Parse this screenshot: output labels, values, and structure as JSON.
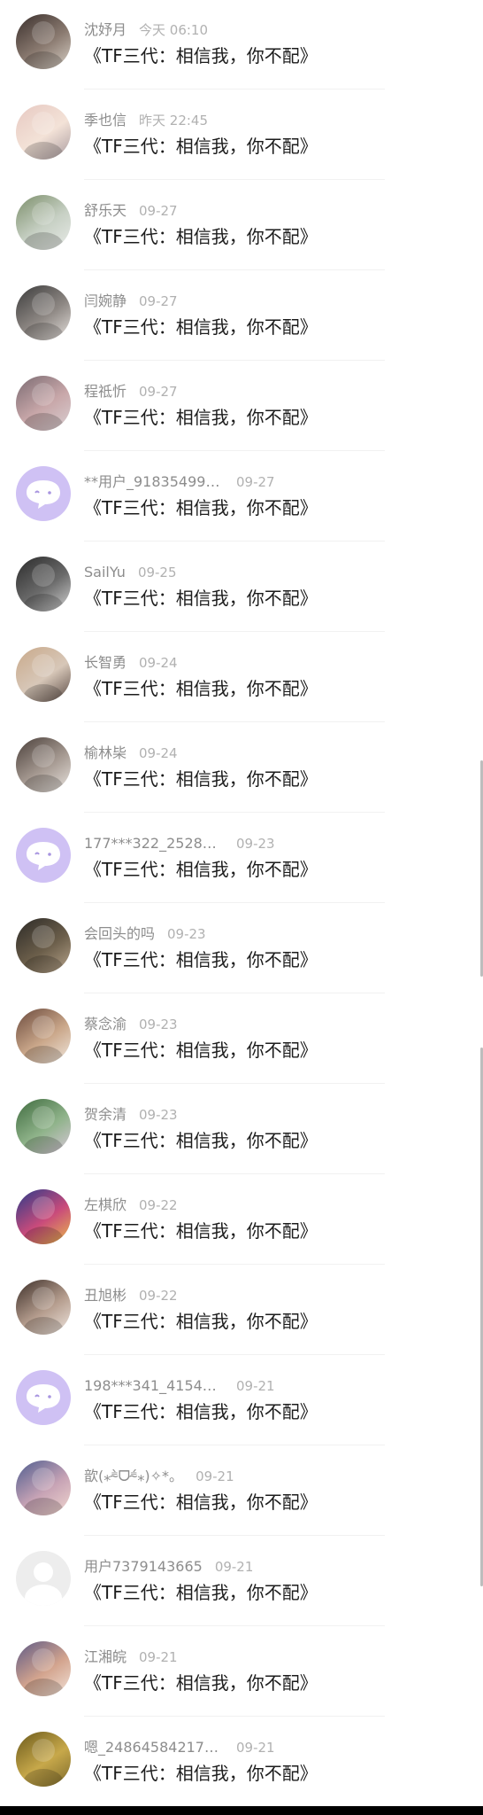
{
  "comments": [
    {
      "name": "沈妤月",
      "time": "今天 06:10",
      "content": "《TF三代：相信我，你不配》",
      "avatar": "photo",
      "colors": [
        "#3a2f2c",
        "#8a7a70",
        "#d8d0c6"
      ]
    },
    {
      "name": "季也信",
      "time": "昨天 22:45",
      "content": "《TF三代：相信我，你不配》",
      "avatar": "photo",
      "colors": [
        "#e7c9c2",
        "#f3e2d7",
        "#a99b9f"
      ]
    },
    {
      "name": "舒乐天",
      "time": "09-27",
      "content": "《TF三代：相信我，你不配》",
      "avatar": "photo",
      "colors": [
        "#7c8f6b",
        "#c7d0c4",
        "#e8ebe8"
      ]
    },
    {
      "name": "闫婉静",
      "time": "09-27",
      "content": "《TF三代：相信我，你不配》",
      "avatar": "photo",
      "colors": [
        "#3b3b3b",
        "#8d8783",
        "#e6e1dd"
      ]
    },
    {
      "name": "程祗忻",
      "time": "09-27",
      "content": "《TF三代：相信我，你不配》",
      "avatar": "photo",
      "colors": [
        "#7b6b72",
        "#c8a7a9",
        "#d9cfd2"
      ]
    },
    {
      "name": "**用户_91835499…",
      "time": "09-27",
      "content": "《TF三代：相信我，你不配》",
      "avatar": "default",
      "colors": [
        "#cfc1f4"
      ]
    },
    {
      "name": "SailYu",
      "time": "09-25",
      "content": "《TF三代：相信我，你不配》",
      "avatar": "photo",
      "colors": [
        "#2a2a2a",
        "#6a6a6a",
        "#d2d2d2"
      ]
    },
    {
      "name": "长智勇",
      "time": "09-24",
      "content": "《TF三代：相信我，你不配》",
      "avatar": "photo",
      "colors": [
        "#c9a98a",
        "#d7c7b8",
        "#5a4a44"
      ]
    },
    {
      "name": "榆林枈",
      "time": "09-24",
      "content": "《TF三代：相信我，你不配》",
      "avatar": "photo",
      "colors": [
        "#4a3f3a",
        "#a69a92",
        "#e9e4df"
      ]
    },
    {
      "name": "177***322_25280…",
      "time": "09-23",
      "content": "《TF三代：相信我，你不配》",
      "avatar": "default",
      "colors": [
        "#cfc1f4"
      ]
    },
    {
      "name": "会回头的吗",
      "time": "09-23",
      "content": "《TF三代：相信我，你不配》",
      "avatar": "photo",
      "colors": [
        "#2c2a27",
        "#6b5e4a",
        "#b8a58c"
      ]
    },
    {
      "name": "蔡念渝",
      "time": "09-23",
      "content": "《TF三代：相信我，你不配》",
      "avatar": "photo",
      "colors": [
        "#6b4a3d",
        "#caa78a",
        "#f0e7dd"
      ]
    },
    {
      "name": "贺余清",
      "time": "09-23",
      "content": "《TF三代：相信我，你不配》",
      "avatar": "photo",
      "colors": [
        "#3f6b3f",
        "#8fb38a",
        "#d8c7d9"
      ]
    },
    {
      "name": "左棋欣",
      "time": "09-22",
      "content": "《TF三代：相信我，你不配》",
      "avatar": "photo",
      "colors": [
        "#2b3b8a",
        "#c94b7b",
        "#e8b94a"
      ]
    },
    {
      "name": "丑旭彬",
      "time": "09-22",
      "content": "《TF三代：相信我，你不配》",
      "avatar": "photo",
      "colors": [
        "#3d2f29",
        "#b59d8e",
        "#efe6df"
      ]
    },
    {
      "name": "198***341_41546…",
      "time": "09-21",
      "content": "《TF三代：相信我，你不配》",
      "avatar": "default",
      "colors": [
        "#cfc1f4"
      ]
    },
    {
      "name": "歆(⁎⁼̴̀ᗜ⁼̴́⁎)✧*。",
      "time": "09-21",
      "content": "《TF三代：相信我，你不配》",
      "avatar": "photo",
      "colors": [
        "#4f5d8f",
        "#c7a3b5",
        "#f1d7cf"
      ]
    },
    {
      "name": "用户7379143665",
      "time": "09-21",
      "content": "《TF三代：相信我，你不配》",
      "avatar": "blank",
      "colors": [
        "#ededed"
      ]
    },
    {
      "name": "江湘皖",
      "time": "09-21",
      "content": "《TF三代：相信我，你不配》",
      "avatar": "photo",
      "colors": [
        "#5e5a86",
        "#d3a48e",
        "#f1e2d8"
      ]
    },
    {
      "name": "嗯_24864584217…",
      "time": "09-21",
      "content": "《TF三代：相信我，你不配》",
      "avatar": "photo",
      "colors": [
        "#6b5a1c",
        "#c7a84a",
        "#7d6a2c"
      ]
    }
  ]
}
